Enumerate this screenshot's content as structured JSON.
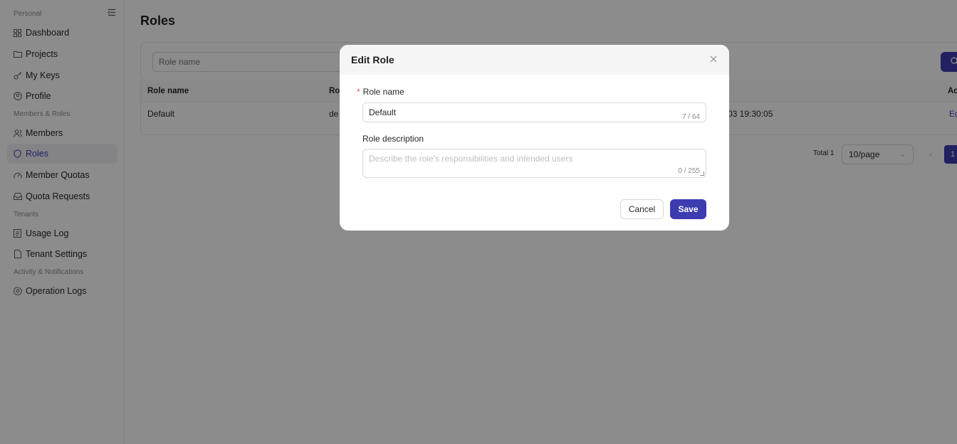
{
  "sidebar": {
    "sections": {
      "personal": "Personal",
      "members_roles": "Members & Roles",
      "tenants": "Tenants",
      "activity": "Activity & Notifications"
    },
    "collapse_icon": "sidebar-collapse-icon",
    "items": [
      {
        "label": "Dashboard",
        "icon": "grid-icon",
        "active": false
      },
      {
        "label": "Projects",
        "icon": "folder-icon",
        "active": false
      },
      {
        "label": "My Keys",
        "icon": "key-icon",
        "active": false
      },
      {
        "label": "Profile",
        "icon": "user-circle-icon",
        "active": false
      },
      {
        "label": "Members",
        "icon": "users-icon",
        "active": false
      },
      {
        "label": "Roles",
        "icon": "shield-icon",
        "active": true
      },
      {
        "label": "Member Quotas",
        "icon": "gauge-icon",
        "active": false
      },
      {
        "label": "Quota Requests",
        "icon": "inbox-icon",
        "active": false
      },
      {
        "label": "Usage Log",
        "icon": "log-icon",
        "active": false
      },
      {
        "label": "Tenant Settings",
        "icon": "document-icon",
        "active": false
      },
      {
        "label": "Operation Logs",
        "icon": "settings-log-icon",
        "active": false
      }
    ]
  },
  "main": {
    "title": "Roles",
    "filter": {
      "placeholder": "Role name",
      "search_icon": "search-icon"
    },
    "table": {
      "columns": [
        "Role name",
        "Ro",
        "Ac"
      ],
      "rows": [
        {
          "name": "Default",
          "code": "de",
          "time": "03 19:30:05",
          "action": "Ed"
        }
      ]
    },
    "pagination": {
      "total": "Total 1",
      "page_size": "10/page",
      "current_page": "1"
    }
  },
  "modal": {
    "title": "Edit Role",
    "close_icon": "close-icon",
    "fields": {
      "name": {
        "label": "Role name",
        "required_mark": "*",
        "value": "Default",
        "counter": "7 / 64"
      },
      "description": {
        "label": "Role description",
        "placeholder": "Describe the role's responsibilities and intended users",
        "counter": "0 / 255"
      }
    },
    "buttons": {
      "cancel": "Cancel",
      "save": "Save"
    }
  },
  "colors": {
    "primary": "#3c3bb0",
    "required": "#ff4d4f",
    "mask": "rgba(0,0,0,0.45)"
  }
}
